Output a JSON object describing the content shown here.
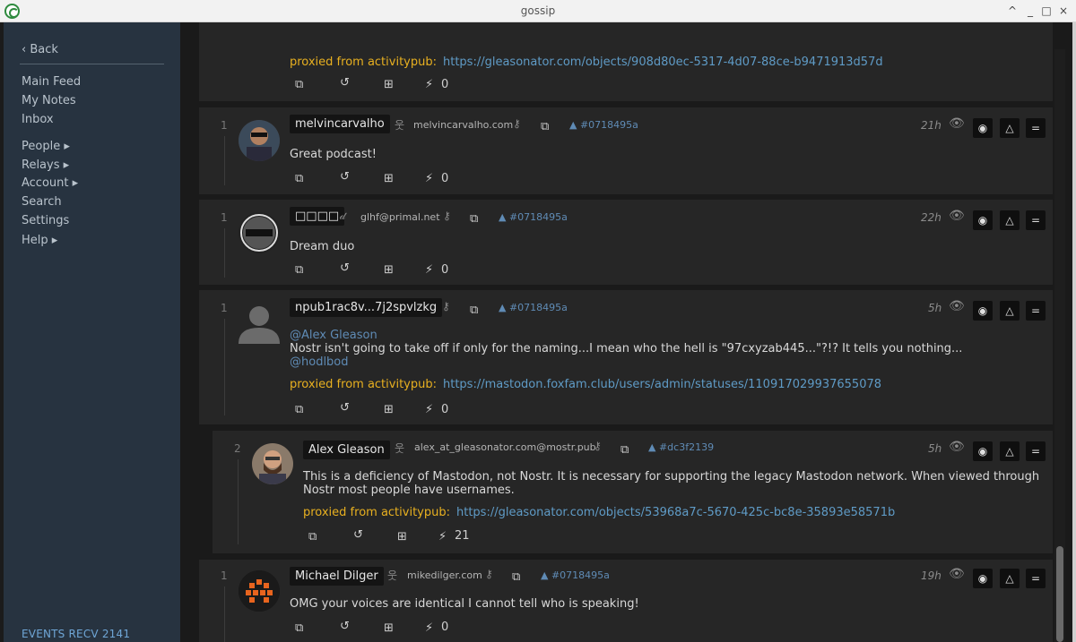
{
  "window": {
    "title": "gossip",
    "controls": [
      "^",
      "_",
      "□",
      "×"
    ]
  },
  "sidebar": {
    "back_label": "‹ Back",
    "items": [
      {
        "label": "Main Feed"
      },
      {
        "label": "My Notes"
      },
      {
        "label": "Inbox"
      },
      {
        "label": "People ▸"
      },
      {
        "label": "Relays ▸"
      },
      {
        "label": "Account ▸"
      },
      {
        "label": "Search"
      },
      {
        "label": "Settings"
      },
      {
        "label": "Help ▸"
      }
    ],
    "events_label": "EVENTS RECV 2141"
  },
  "feed": {
    "top_card": {
      "proxy_label": "proxied from activitypub:",
      "proxy_url": "https://gleasonator.com/objects/908d80ec-5317-4d07-88ce-b9471913d57d",
      "zap_count": "0"
    },
    "notes": [
      {
        "reply_count": "1",
        "name": "melvincarvalho",
        "nip05": "melvincarvalho.com",
        "ref": "▲ #0718495a",
        "time": "21h",
        "content": "Great podcast!",
        "zap_count": "0"
      },
      {
        "reply_count": "1",
        "name": "□□□□",
        "nip05": "glhf@primal.net",
        "ref": "▲ #0718495a",
        "time": "22h",
        "content": "Dream duo",
        "zap_count": "0"
      },
      {
        "reply_count": "1",
        "name": "npub1rac8v...7j2spvlzkg",
        "ref": "▲ #0718495a",
        "time": "5h",
        "mention1": "@Alex Gleason",
        "content": "Nostr isn't going to take off if only for the naming...I mean who the hell is \"97cxyzab445...\"?!? It tells you nothing...",
        "mention2": "@hodlbod",
        "proxy_label": "proxied from activitypub:",
        "proxy_url": "https://mastodon.foxfam.club/users/admin/statuses/110917029937655078",
        "zap_count": "0"
      },
      {
        "reply_count": "2",
        "name": "Alex Gleason",
        "nip05": "alex_at_gleasonator.com@mostr.pub",
        "ref": "▲ #dc3f2139",
        "time": "5h",
        "content_line1": "This is a deficiency of Mastodon, not Nostr. It is necessary for supporting the legacy Mastodon network. When viewed through",
        "content_line2": "Nostr most people have usernames.",
        "proxy_label": "proxied from activitypub:",
        "proxy_url": "https://gleasonator.com/objects/53968a7c-5670-425c-bc8e-35893e58571b",
        "zap_count": "21"
      },
      {
        "reply_count": "1",
        "name": "Michael Dilger",
        "nip05": "mikedilger.com",
        "ref": "▲ #0718495a",
        "time": "19h",
        "content": "OMG your voices are identical I cannot tell who is speaking!",
        "zap_count": "0"
      }
    ]
  },
  "icons": {
    "copy": "copy-icon",
    "reply": "reply-icon",
    "quote": "quote-icon",
    "zap": "zap-icon",
    "key": "key-icon",
    "person": "person-icon",
    "eye": "eye-icon",
    "pin": "pin-icon",
    "upvote": "triangle-icon",
    "menu": "menu-icon",
    "zap_glyph": "⚡",
    "menu_glyph": "=",
    "triangle_glyph": "△",
    "dot_glyph": "◉"
  },
  "colors": {
    "proxy": "#e8b020",
    "link": "#5f9bc6",
    "sidebar": "#273340",
    "card": "#262626"
  }
}
